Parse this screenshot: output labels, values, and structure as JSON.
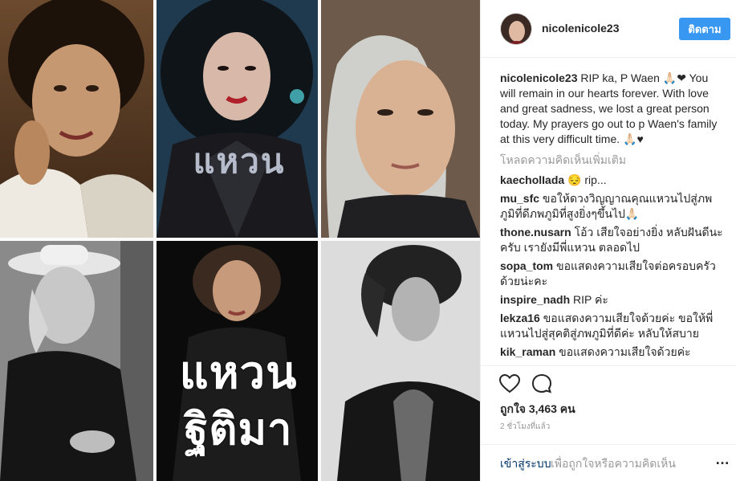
{
  "collage": {
    "overlay_line1": "แหวน",
    "overlay_line2": "ฐิติมา",
    "album_text": "แหวน"
  },
  "post": {
    "username": "nicolenicole23",
    "follow_label": "ติดตาม",
    "caption_text": "RIP ka, P Waen 🙏🏻❤ You will remain in our hearts forever. With love and great sadness, we lost a great person today. My prayers go out to p Waen's family at this very difficult time. 🙏🏻♥",
    "load_more": "โหลดความคิดเห็นเพิ่มเติม",
    "comments": [
      {
        "user": "kaecholIada",
        "text": "😔 rip..."
      },
      {
        "user": "mu_sfc",
        "text": "ขอให้ดวงวิญญาณคุณแหวนไปสู่ภพภูมิที่ดีภพภูมิที่สูงยิ่งๆขึ้นไป🙏🏻"
      },
      {
        "user": "thone.nusarn",
        "text": "โอ้ว เสียใจอย่างยิ่ง หลับฝันดีนะครับ เรายังมีพี่แหวน ตลอดไป"
      },
      {
        "user": "sopa_tom",
        "text": "ขอแสดงความเสียใจต่อครอบครัวด้วยน่ะคะ"
      },
      {
        "user": "inspire_nadh",
        "text": "RIP ค่ะ"
      },
      {
        "user": "lekza16",
        "text": "ขอแสดงความเสียใจด้วยค่ะ ขอให้พี่แหวนไปสู่สุคติสู่ภพภูมิที่ดีค่ะ หลับให้สบาย"
      },
      {
        "user": "kik_raman",
        "text": "ขอแสดงความเสียใจด้วยค่ะ"
      }
    ],
    "likes": "ถูกใจ 3,463 คน",
    "time": "2 ชั่วโมงที่แล้ว",
    "login_link": "เข้าสู่ระบบ",
    "login_text": "เพื่อถูกใจหรือความคิดเห็น",
    "more_icon": "…"
  },
  "colors": {
    "accent": "#3897f0",
    "link": "#003569",
    "muted": "#999999",
    "text": "#262626",
    "divider": "#efefef"
  }
}
